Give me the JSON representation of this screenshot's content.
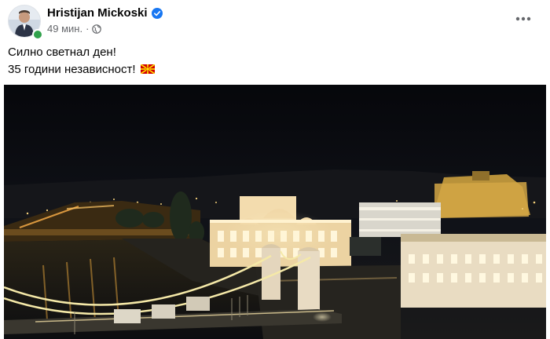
{
  "post": {
    "author": "Hristijan Mickoski",
    "time": "49 мин.",
    "separator": "·",
    "text_line_1": "Силно светнал ден!",
    "text_line_2": "35 години независност!"
  },
  "icons": {
    "verified": "verified-badge-icon",
    "audience": "globe-icon",
    "more": "more-options-icon",
    "flag": "flag-north-macedonia-icon"
  },
  "colors": {
    "verified_blue": "#1877f2",
    "online_green": "#31a24c",
    "meta_gray": "#65676b"
  }
}
